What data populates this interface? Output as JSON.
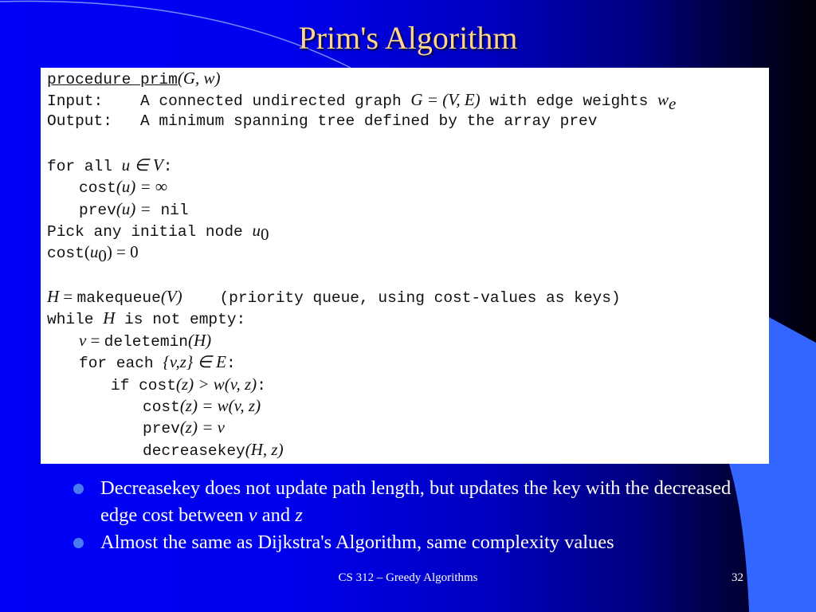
{
  "slide": {
    "title": "Prim's Algorithm",
    "colors": {
      "title": "#ffd58a",
      "background_left": "#0000f6",
      "background_right": "#000008",
      "accent_shape": "#3366ff",
      "bullet_dot": "#4a7af0"
    },
    "code": {
      "procedure_keyword": "procedure prim",
      "procedure_args": "(G, w)",
      "input_label": "Input:",
      "input_text": "A connected undirected graph",
      "input_math": "G = (V, E)",
      "input_text2": "with edge weights",
      "input_math2": "w",
      "input_math2_sub": "e",
      "output_label": "Output:",
      "output_text": "A minimum spanning tree defined by the array prev",
      "for_all_kw": "for all",
      "for_all_math": "u ∈ V",
      "colon": ":",
      "cost_kw": "cost",
      "cost_u_math": "(u) = ∞",
      "prev_kw": "prev",
      "prev_u_math": "(u) =",
      "nil_kw": "nil",
      "pick_text": "Pick any initial node",
      "u_math": "u",
      "zero_sub": "0",
      "cost_u0_open": "(",
      "cost_u0_close": ") = 0",
      "h_math": "H",
      "eq": " = ",
      "makequeue_kw": "makequeue",
      "makequeue_arg": "(V)",
      "makequeue_comment": "(priority queue, using cost-values as keys)",
      "while_kw": "while",
      "while_rest": "is not empty:",
      "v_math": "v",
      "deletemin_kw": "deletemin",
      "deletemin_arg": "(H)",
      "for_each_kw": "for each",
      "for_each_math": "{v,z} ∈ E",
      "if_kw": "if",
      "if_math": "(z) > w(v, z)",
      "cost_z_math": "(z) = w(v, z)",
      "prev_z_math": "(z) = v",
      "decreasekey_kw": "decreasekey",
      "decreasekey_arg": "(H, z)"
    },
    "bullets": [
      {
        "text_before": "Decreasekey does not update path length, but updates the key with the decreased edge cost between ",
        "italic1": "v",
        "mid": " and ",
        "italic2": "z"
      },
      {
        "text": "Almost the same as Dijkstra's Algorithm, same complexity values"
      }
    ],
    "footer": {
      "course": "CS 312 – Greedy Algorithms",
      "page_number": "32"
    }
  }
}
